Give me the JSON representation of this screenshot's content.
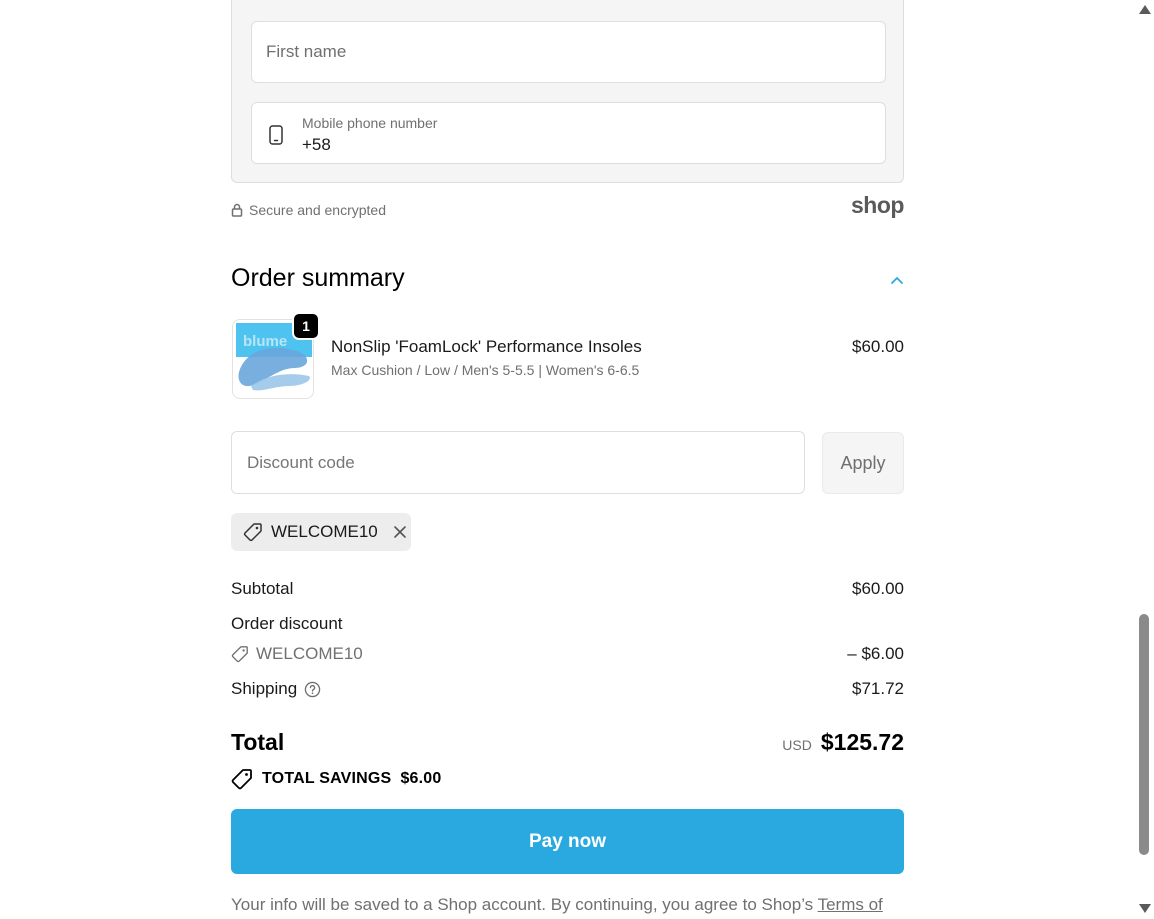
{
  "contact": {
    "first_name_placeholder": "First name",
    "phone_label": "Mobile phone number",
    "phone_value": "+58"
  },
  "security": {
    "secure_text": "Secure and encrypted",
    "shop_logo": "shop"
  },
  "order_summary": {
    "title": "Order summary",
    "toggle_icon": "chevron-up-icon"
  },
  "product": {
    "quantity": "1",
    "name": "NonSlip 'FoamLock'  Performance Insoles",
    "variant": "Max Cushion / Low / Men's 5-5.5 | Women's 6-6.5",
    "price": "$60.00",
    "thumb_text": "blume"
  },
  "discount": {
    "placeholder": "Discount code",
    "apply_label": "Apply",
    "applied_code": "WELCOME10"
  },
  "totals": {
    "subtotal_label": "Subtotal",
    "subtotal_value": "$60.00",
    "order_discount_label": "Order discount",
    "discount_code": "WELCOME10",
    "discount_value": "– $6.00",
    "shipping_label": "Shipping",
    "shipping_value": "$71.72",
    "total_label": "Total",
    "currency": "USD",
    "total_value": "$125.72",
    "savings_label": "TOTAL SAVINGS",
    "savings_value": "$6.00"
  },
  "actions": {
    "pay_label": "Pay now"
  },
  "legal": {
    "text": "Your info will be saved to a Shop account. By continuing, you agree to Shop’s ",
    "link_text": "Terms of"
  },
  "colors": {
    "accent": "#2aa9e0",
    "muted_text": "#707070",
    "panel_bg": "#f5f5f5"
  }
}
